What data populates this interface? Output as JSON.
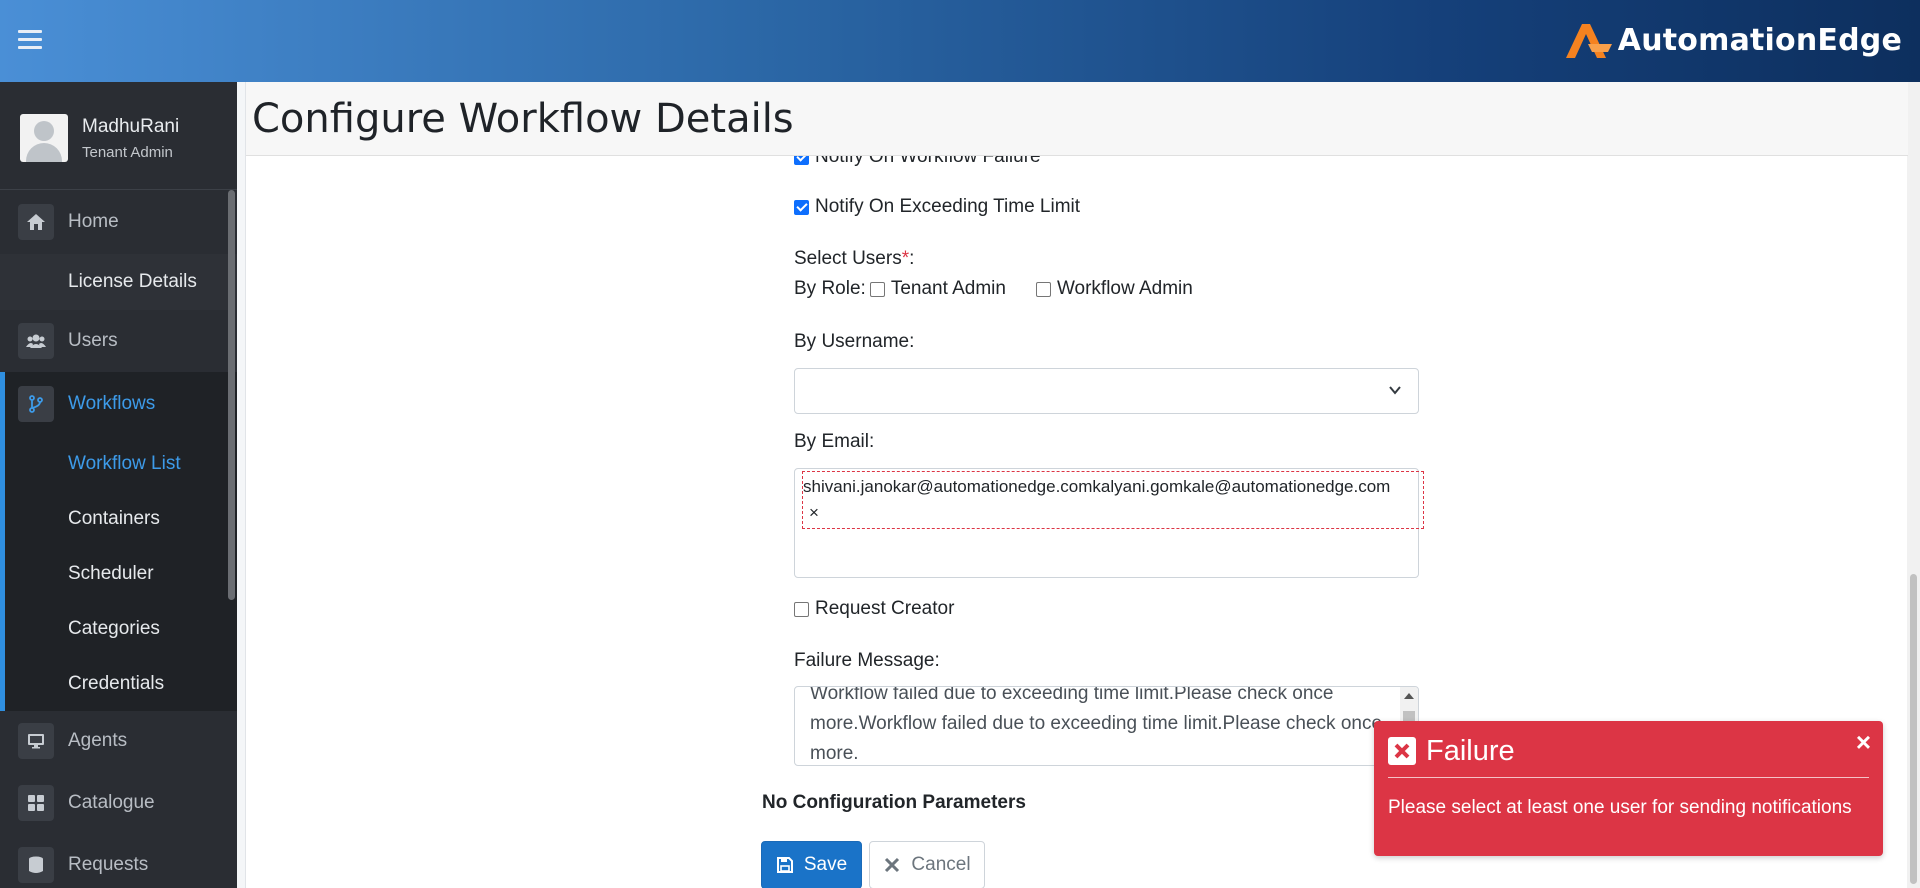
{
  "header": {
    "logo_text": "AutomationEdge"
  },
  "user": {
    "name": "MadhuRani",
    "role": "Tenant Admin"
  },
  "sidebar": {
    "home": "Home",
    "license": "License Details",
    "users": "Users",
    "workflows": "Workflows",
    "workflow_subs": [
      "Workflow List",
      "Containers",
      "Scheduler",
      "Categories",
      "Credentials"
    ],
    "agents": "Agents",
    "catalogue": "Catalogue",
    "requests": "Requests"
  },
  "page": {
    "title": "Configure Workflow Details"
  },
  "form": {
    "notify_failure": {
      "label": "Notify On Workflow Failure",
      "checked": true
    },
    "notify_time": {
      "label": "Notify On Exceeding Time Limit",
      "checked": true
    },
    "select_users_label": "Select Users",
    "select_users_req": "*",
    "select_users_colon": ":",
    "by_role_label": "By Role:",
    "role_tenant_admin": "Tenant Admin",
    "role_workflow_admin": "Workflow Admin",
    "by_username_label": "By Username:",
    "by_email_label": "By Email:",
    "email_token": "shivani.janokar@automationedge.comkalyani.gomkale@automationedge.com",
    "email_token_remove": "×",
    "request_creator": "Request Creator",
    "failure_message_label": "Failure Message:",
    "failure_message_text": "Workflow failed due to exceeding time limit.Please check once more.Workflow failed due to exceeding time limit.Please check once more.",
    "no_config": "No Configuration Parameters",
    "save": "Save",
    "cancel": "Cancel"
  },
  "toast": {
    "title": "Failure",
    "close": "×",
    "message": "Please select at least one user for sending notifications",
    "color": "#dc3545"
  },
  "colors": {
    "accent": "#3d9be9",
    "primary_button": "#1a73c8",
    "sidebar_bg": "#2a2d33"
  }
}
